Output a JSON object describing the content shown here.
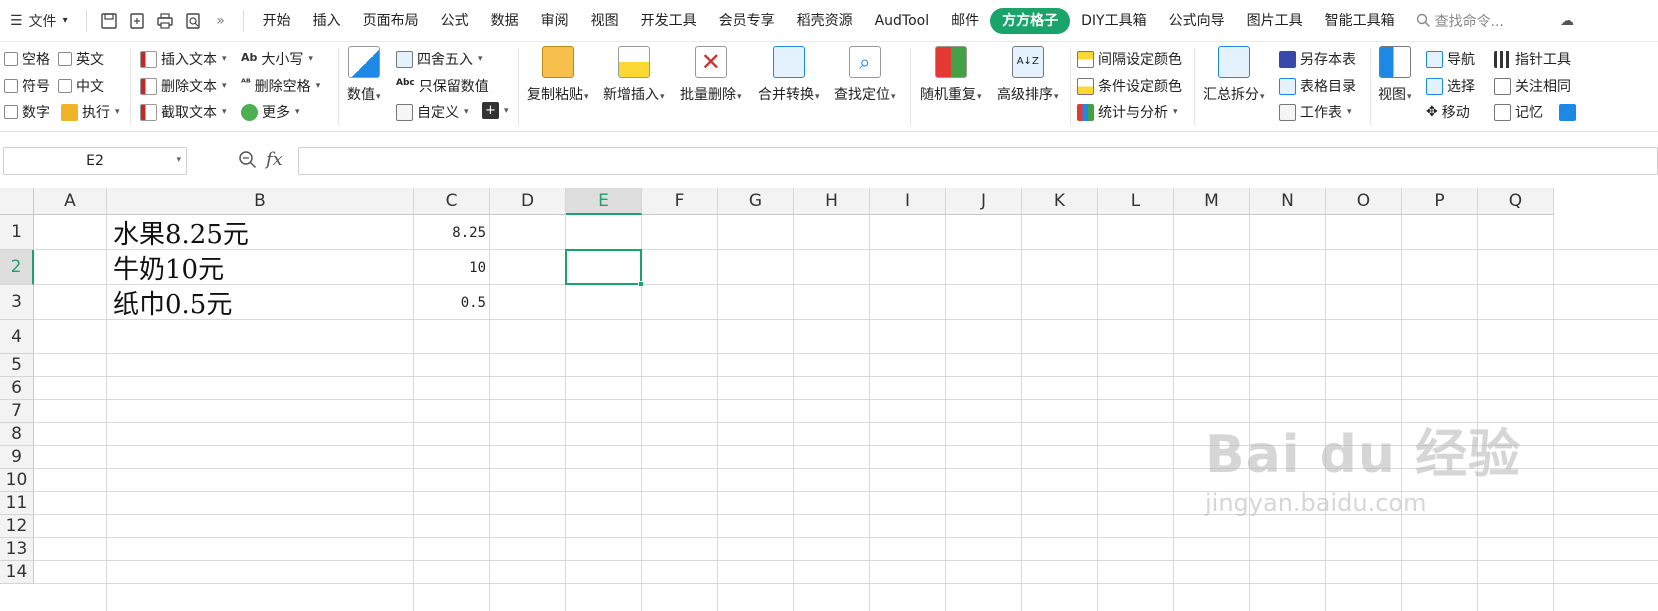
{
  "menubar": {
    "file_label": "文件",
    "tabs": [
      "开始",
      "插入",
      "页面布局",
      "公式",
      "数据",
      "审阅",
      "视图",
      "开发工具",
      "会员专享",
      "稻壳资源",
      "AudTool",
      "邮件",
      "方方格子",
      "DIY工具箱",
      "公式向导",
      "图片工具",
      "智能工具箱"
    ],
    "active_tab": "方方格子",
    "search_placeholder": "查找命令...",
    "accent_color": "#1aa36b"
  },
  "ribbon": {
    "chk_space": "空格",
    "chk_english": "英文",
    "chk_symbol": "符号",
    "chk_chinese": "中文",
    "chk_number": "数字",
    "execute": "执行",
    "insert_text": "插入文本",
    "delete_text": "删除文本",
    "extract_text": "截取文本",
    "case": "大小写",
    "delete_space": "删除空格",
    "more": "更多",
    "value": "数值",
    "round": "四舍五入",
    "keep_value": "只保留数值",
    "custom": "自定义",
    "copy_paste": "复制粘贴",
    "new_insert": "新增插入",
    "batch_delete": "批量删除",
    "merge_convert": "合并转换",
    "find_locate": "查找定位",
    "random_repeat": "随机重复",
    "advanced_sort": "高级排序",
    "interval_color": "间隔设定颜色",
    "cond_color": "条件设定颜色",
    "stats_analysis": "统计与分析",
    "summary_split": "汇总拆分",
    "save_sheet": "另存本表",
    "sheet_index": "表格目录",
    "worksheet": "工作表",
    "view": "视图",
    "navigate": "导航",
    "select": "选择",
    "move": "移动",
    "pointer_tool": "指针工具",
    "focus_same": "关注相同",
    "memory": "记忆"
  },
  "formula": {
    "cell_ref": "E2",
    "fx_label": "fx",
    "content": ""
  },
  "sheet": {
    "columns": [
      "A",
      "B",
      "C",
      "D",
      "E",
      "F",
      "G",
      "H",
      "I",
      "J",
      "K",
      "L",
      "M",
      "N",
      "O",
      "P",
      "Q"
    ],
    "rows": [
      "1",
      "2",
      "3",
      "4",
      "5",
      "6",
      "7",
      "8",
      "9",
      "10",
      "11",
      "12",
      "13",
      "14"
    ],
    "selected_col": "E",
    "selected_row": "2",
    "b1": "水果8.25元",
    "b2": "牛奶10元",
    "b3": "纸巾0.5元",
    "c1": "8.25",
    "c2": "10",
    "c3": "0.5"
  },
  "watermark": {
    "brand": "Bai du 经验",
    "url": "jingyan.baidu.com"
  }
}
